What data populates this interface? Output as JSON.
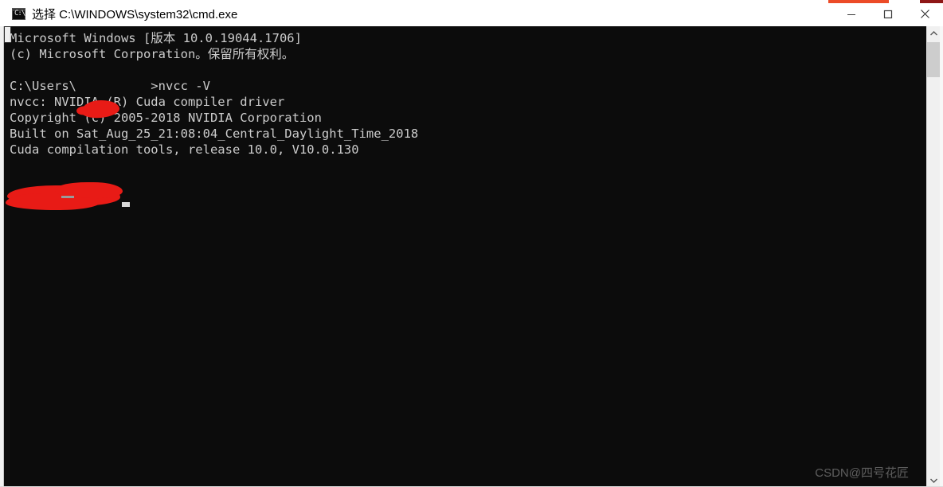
{
  "window": {
    "title": "选择 C:\\WINDOWS\\system32\\cmd.exe",
    "icon": "cmd-icon",
    "icon_glyph": "C:\\",
    "controls": {
      "minimize": "最小化",
      "maximize": "最大化",
      "close": "关闭"
    }
  },
  "console": {
    "background_color": "#0c0c0c",
    "foreground_color": "#cccccc",
    "lines": [
      "Microsoft Windows [版本 10.0.19044.1706]",
      "(c) Microsoft Corporation。保留所有权利。",
      "",
      "C:\\Users\\          >nvcc -V",
      "nvcc: NVIDIA (R) Cuda compiler driver",
      "Copyright (c) 2005-2018 NVIDIA Corporation",
      "Built on Sat_Aug_25_21:08:04_Central_Daylight_Time_2018",
      "Cuda compilation tools, release 10.0, V10.0.130",
      ""
    ],
    "text": "Microsoft Windows [版本 10.0.19044.1706]\n(c) Microsoft Corporation。保留所有权利。\n\nC:\\Users\\          >nvcc -V\nnvcc: NVIDIA (R) Cuda compiler driver\nCopyright (c) 2005-2018 NVIDIA Corporation\nBuilt on Sat_Aug_25_21:08:04_Central_Daylight_Time_2018\nCuda compilation tools, release 10.0, V10.0.130",
    "command": "nvcc -V",
    "cuda_release": "10.0",
    "cuda_version": "V10.0.130"
  },
  "redactions": {
    "color": "#e81b16",
    "username_mark": "redacted-username",
    "prompt_line_mark": "redacted-prompt-line"
  },
  "scrollbar": {
    "up_arrow": "▲",
    "down_arrow": "▼"
  },
  "watermark": {
    "text": "CSDN@四号花匠"
  }
}
